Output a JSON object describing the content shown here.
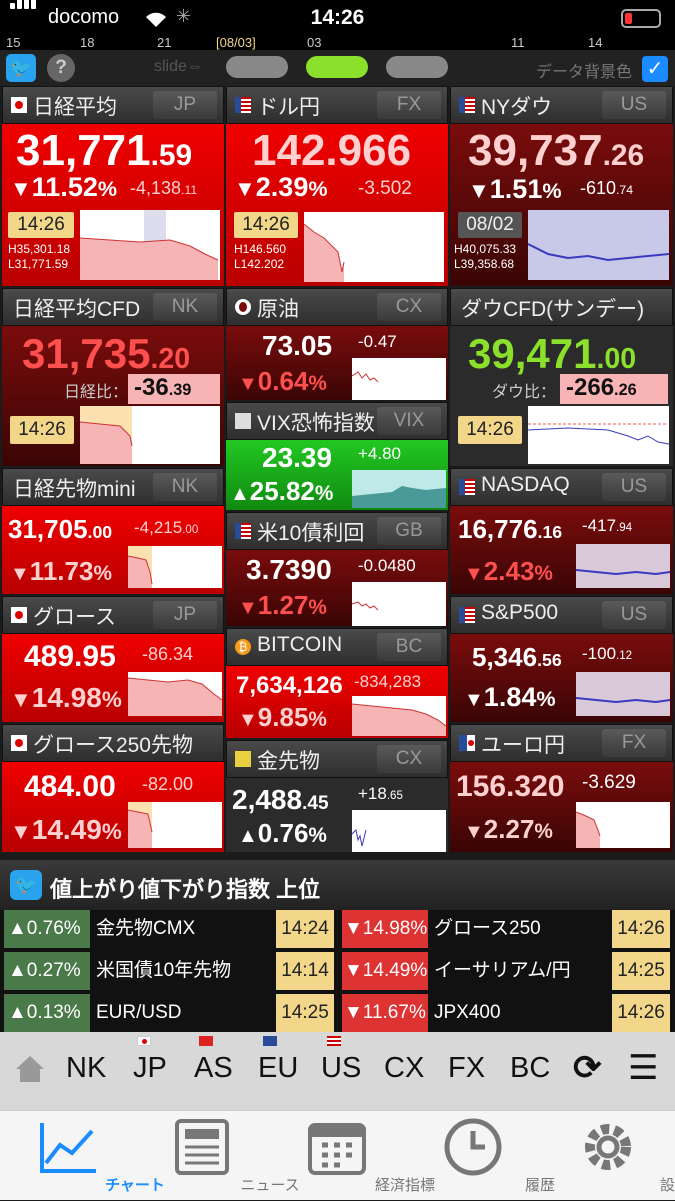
{
  "status": {
    "carrier": "docomo",
    "time": "14:26",
    "battery": "20%"
  },
  "ticks": [
    "15",
    "18",
    "21",
    "[08/03]",
    "03",
    "11",
    "14"
  ],
  "toolbar": {
    "slide": "slide⇔",
    "bg_label": "データ背景色"
  },
  "panels": {
    "nikkei": {
      "title": "日経平均",
      "code": "JP",
      "price_int": "31,771",
      "price_dec": ".59",
      "pct": "11.52",
      "pct_sym": "%",
      "chg": "-4,138",
      "chg_dec": ".11",
      "time": "14:26",
      "high": "H35,301.18",
      "low": "L31,771.59"
    },
    "usdjpy": {
      "title": "ドル円",
      "code": "FX",
      "price": "142.966",
      "pct": "2.39",
      "pct_sym": "%",
      "chg": "-3.502",
      "time": "14:26",
      "high": "H146.560",
      "low": "L142.202"
    },
    "nydow": {
      "title": "NYダウ",
      "code": "US",
      "price_int": "39,737",
      "price_dec": ".26",
      "pct": "1.51",
      "pct_sym": "%",
      "chg": "-610",
      "chg_dec": ".74",
      "time": "08/02",
      "high": "H40,075.33",
      "low": "L39,358.68"
    },
    "nk_cfd": {
      "title": "日経平均CFD",
      "code": "NK",
      "price_int": "31,735",
      "price_dec": ".20",
      "cmp_label": "日経比：",
      "cmp_int": "-36",
      "cmp_dec": ".39",
      "time": "14:26"
    },
    "oil": {
      "title": "原油",
      "code": "CX",
      "price": "73.05",
      "chg": "-0.47",
      "pct": "0.64",
      "pct_sym": "%"
    },
    "vix": {
      "title": "VIX恐怖指数",
      "code": "VIX",
      "price": "23.39",
      "chg": "+4.80",
      "pct": "25.82",
      "pct_sym": "%"
    },
    "dow_cfd": {
      "title": "ダウCFD(サンデー)",
      "price_int": "39,471",
      "price_dec": ".00",
      "cmp_label": "ダウ比：",
      "cmp_int": "-266",
      "cmp_dec": ".26",
      "time": "14:26"
    },
    "nk_mini": {
      "title": "日経先物mini",
      "code": "NK",
      "price_int": "31,705",
      "price_dec": ".00",
      "chg": "-4,215",
      "chg_dec": ".00",
      "pct": "11.73",
      "pct_sym": "%"
    },
    "us10y": {
      "title": "米10債利回",
      "code": "GB",
      "price": "3.7390",
      "chg": "-0.0480",
      "pct": "1.27",
      "pct_sym": "%"
    },
    "nasdaq": {
      "title": "NASDAQ",
      "code": "US",
      "price_int": "16,776",
      "price_dec": ".16",
      "chg": "-417",
      "chg_dec": ".94",
      "pct": "2.43",
      "pct_sym": "%"
    },
    "growth": {
      "title": "グロース",
      "code": "JP",
      "price": "489.95",
      "chg": "-86.34",
      "pct": "14.98",
      "pct_sym": "%"
    },
    "bitcoin": {
      "title": "BITCOIN",
      "code": "BC",
      "price": "7,634,126",
      "chg": "-834,283",
      "pct": "9.85",
      "pct_sym": "%"
    },
    "sp500": {
      "title": "S&P500",
      "code": "US",
      "price_int": "5,346",
      "price_dec": ".56",
      "chg": "-100",
      "chg_dec": ".12",
      "pct": "1.84",
      "pct_sym": "%"
    },
    "growth250": {
      "title": "グロース250先物",
      "price": "484.00",
      "chg": "-82.00",
      "pct": "14.49",
      "pct_sym": "%"
    },
    "gold": {
      "title": "金先物",
      "code": "CX",
      "price_int": "2,488",
      "price_dec": ".45",
      "chg": "+18",
      "chg_dec": ".65",
      "pct": "0.76",
      "pct_sym": "%"
    },
    "eurjpy": {
      "title": "ユーロ円",
      "code": "FX",
      "price": "156.320",
      "chg": "-3.629",
      "pct": "2.27",
      "pct_sym": "%"
    }
  },
  "ranking": {
    "title": "値上がり値下がり指数 上位",
    "rows": [
      {
        "up_pct": "▲0.76%",
        "up_name": "金先物CMX",
        "up_time": "14:24",
        "dn_pct": "▼14.98%",
        "dn_name": "グロース250",
        "dn_time": "14:26"
      },
      {
        "up_pct": "▲0.27%",
        "up_name": "米国債10年先物",
        "up_time": "14:14",
        "dn_pct": "▼14.49%",
        "dn_name": "イーサリアム/円",
        "dn_time": "14:25"
      },
      {
        "up_pct": "▲0.13%",
        "up_name": "EUR/USD",
        "up_time": "14:25",
        "dn_pct": "▼11.67%",
        "dn_name": "JPX400",
        "dn_time": "14:26"
      }
    ]
  },
  "nav": [
    "NK",
    "JP",
    "AS",
    "EU",
    "US",
    "CX",
    "FX",
    "BC"
  ],
  "tabs": [
    "チャート",
    "ニュース",
    "経済指標",
    "履歴",
    "設定"
  ]
}
